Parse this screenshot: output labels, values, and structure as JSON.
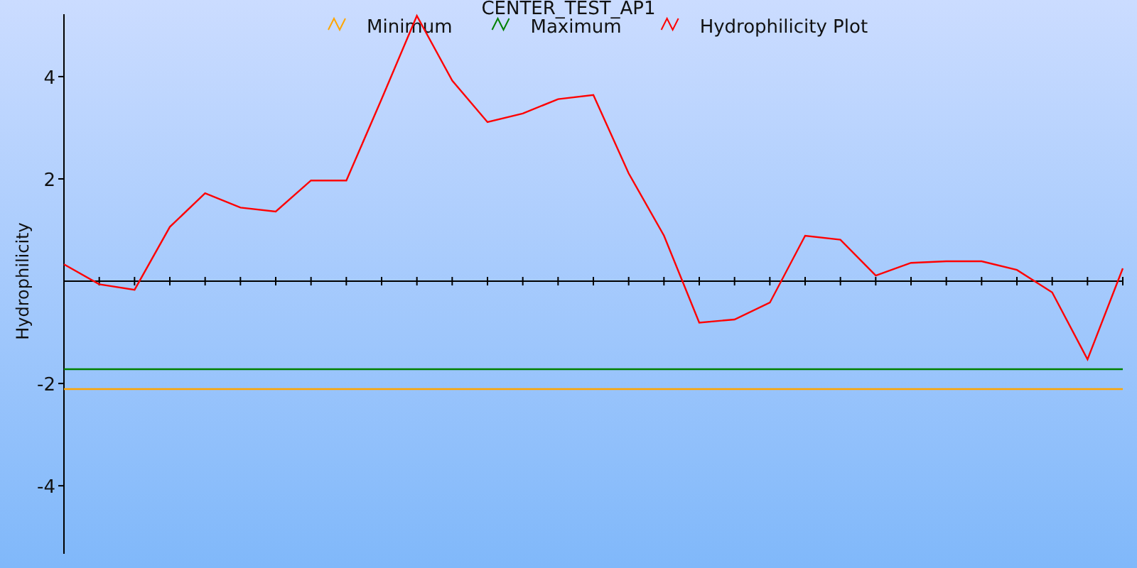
{
  "chart": {
    "title": "CENTER_TEST_AP1",
    "chart_data": {
      "type": "line",
      "legend": true,
      "ylabel": "Hydrophilicity",
      "ylim": [
        -5.33,
        5.22
      ],
      "yticks": [
        -4,
        -2,
        2,
        4
      ],
      "series": [
        {
          "name": "Minimum",
          "color": "#ffa500",
          "values": [
            -2.11,
            -2.11,
            -2.11,
            -2.11,
            -2.11,
            -2.11,
            -2.11,
            -2.11,
            -2.11,
            -2.11,
            -2.11,
            -2.11,
            -2.11,
            -2.11,
            -2.11,
            -2.11,
            -2.11,
            -2.11,
            -2.11,
            -2.11,
            -2.11,
            -2.11,
            -2.11,
            -2.11,
            -2.11,
            -2.11,
            -2.11,
            -2.11,
            -2.11,
            -2.11,
            -2.11
          ]
        },
        {
          "name": "Maximum",
          "color": "#008000",
          "values": [
            -1.72,
            -1.72,
            -1.72,
            -1.72,
            -1.72,
            -1.72,
            -1.72,
            -1.72,
            -1.72,
            -1.72,
            -1.72,
            -1.72,
            -1.72,
            -1.72,
            -1.72,
            -1.72,
            -1.72,
            -1.72,
            -1.72,
            -1.72,
            -1.72,
            -1.72,
            -1.72,
            -1.72,
            -1.72,
            -1.72,
            -1.72,
            -1.72,
            -1.72,
            -1.72,
            -1.72
          ]
        },
        {
          "name": "Hydrophilicity Plot",
          "color": "#ff0000",
          "values": [
            0.33,
            -0.06,
            -0.17,
            1.06,
            1.72,
            1.44,
            1.36,
            1.97,
            1.97,
            3.56,
            5.19,
            3.92,
            3.11,
            3.28,
            3.56,
            3.64,
            2.11,
            0.89,
            -0.81,
            -0.75,
            -0.42,
            0.89,
            0.81,
            0.11,
            0.36,
            0.39,
            0.39,
            0.22,
            -0.22,
            -1.53,
            0.25
          ]
        }
      ]
    }
  }
}
